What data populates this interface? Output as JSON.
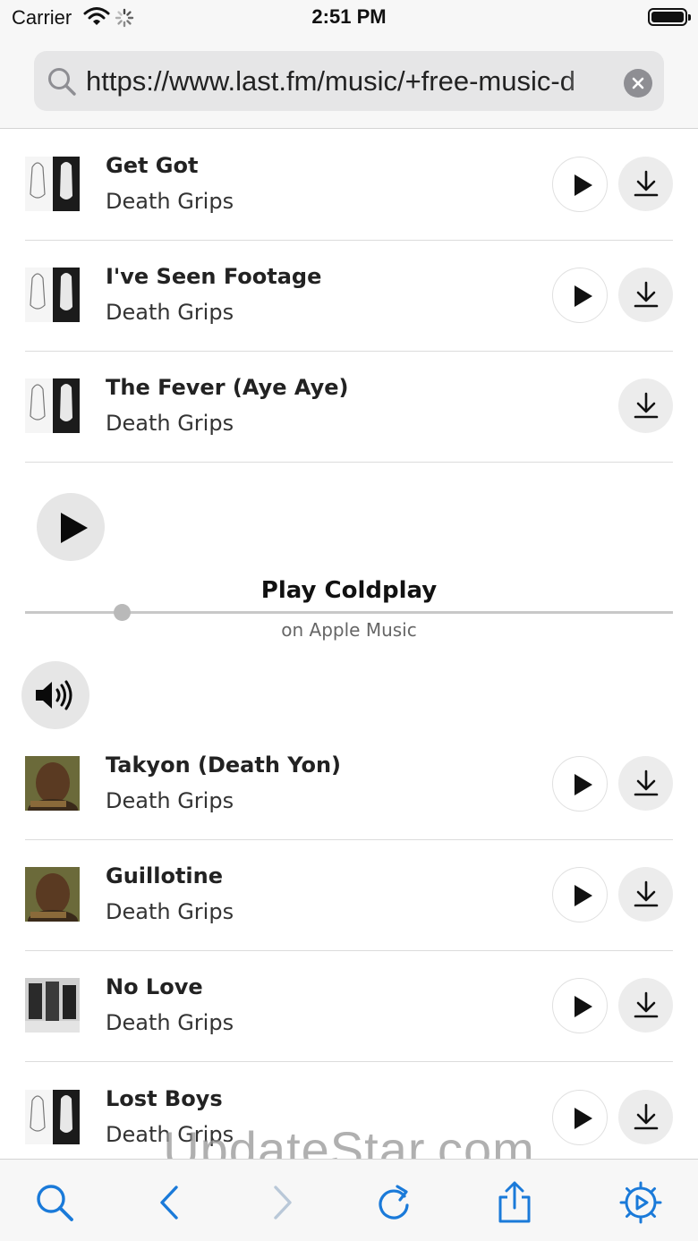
{
  "status_bar": {
    "carrier": "Carrier",
    "time": "2:51 PM"
  },
  "address_bar": {
    "url": "https://www.last.fm/music/+free-music-d"
  },
  "tracks_top": [
    {
      "title": "Get Got",
      "artist": "Death Grips",
      "art": "exmilitary"
    },
    {
      "title": "I've Seen Footage",
      "artist": "Death Grips",
      "art": "exmilitary"
    },
    {
      "title": "The Fever (Aye Aye)",
      "artist": "Death Grips",
      "art": "exmilitary"
    }
  ],
  "mini_player": {
    "title": "Play Coldplay",
    "subtitle": "on Apple Music",
    "progress": 0.15
  },
  "tracks_bottom": [
    {
      "title": "Takyon (Death Yon)",
      "artist": "Death Grips",
      "art": "portrait"
    },
    {
      "title": "Guillotine",
      "artist": "Death Grips",
      "art": "portrait"
    },
    {
      "title": "No Love",
      "artist": "Death Grips",
      "art": "group"
    },
    {
      "title": "Lost Boys",
      "artist": "Death Grips",
      "art": "exmilitary"
    }
  ],
  "watermark": "UpdateStar.com",
  "toolbar": {
    "accent": "#1a7ad9",
    "disabled": "#b9c8d8",
    "icons": [
      "search-icon",
      "back-icon",
      "forward-icon",
      "reload-icon",
      "share-icon",
      "settings-icon"
    ]
  }
}
